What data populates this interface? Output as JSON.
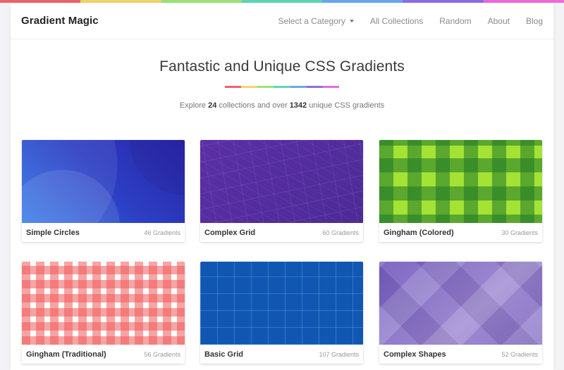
{
  "colors": {
    "rainbow": [
      "#f0626b",
      "#f3d36b",
      "#9de27a",
      "#5fd6b4",
      "#6aa8f0",
      "#8e6ee3",
      "#f06ad8"
    ]
  },
  "navbar": {
    "brand": "Gradient Magic",
    "category_label": "Select a Category",
    "links": [
      "All Collections",
      "Random",
      "About",
      "Blog"
    ]
  },
  "hero": {
    "title": "Fantastic and Unique CSS Gradients",
    "subtitle_prefix": "Explore ",
    "collections_count": "24",
    "subtitle_middle": " collections and over ",
    "gradients_count": "1342",
    "subtitle_suffix": " unique CSS gradients"
  },
  "collections": [
    {
      "title": "Simple Circles",
      "count": "46 Gradients"
    },
    {
      "title": "Complex Grid",
      "count": "60 Gradients"
    },
    {
      "title": "Gingham (Colored)",
      "count": "30 Gradients"
    },
    {
      "title": "Gingham (Traditional)",
      "count": "56 Gradients"
    },
    {
      "title": "Basic Grid",
      "count": "107 Gradients"
    },
    {
      "title": "Complex Shapes",
      "count": "52 Gradients"
    }
  ]
}
